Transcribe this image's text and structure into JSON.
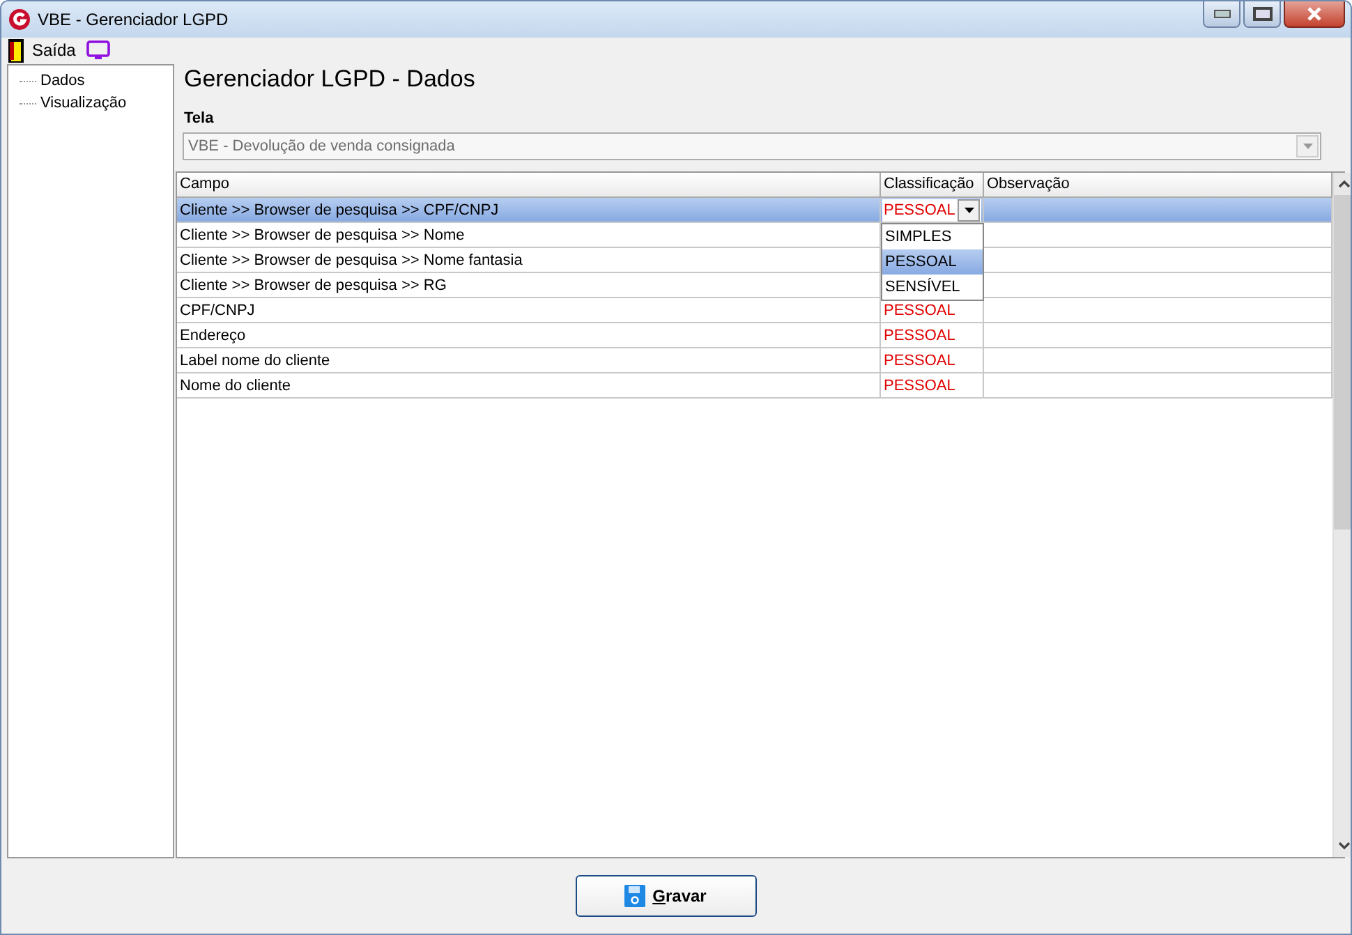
{
  "window": {
    "title": "VBE - Gerenciador LGPD"
  },
  "menu": [
    {
      "label": "Saída",
      "kind": "exit"
    },
    {
      "kind": "screen"
    }
  ],
  "sidebar": {
    "items": [
      {
        "label": "Dados"
      },
      {
        "label": "Visualização"
      }
    ]
  },
  "heading": "Gerenciador LGPD - Dados",
  "tela": {
    "label": "Tela",
    "value": "VBE - Devolução de venda consignada",
    "disabled": true
  },
  "table": {
    "columns": [
      "Campo",
      "Classificação",
      "Observação"
    ],
    "rows": [
      {
        "campo": "Cliente >> Browser de pesquisa >> CPF/CNPJ",
        "classificacao": "PESSOAL",
        "selected": true
      },
      {
        "campo": "Cliente >> Browser de pesquisa >> Nome",
        "selected": false
      },
      {
        "campo": "Cliente >> Browser de pesquisa >> Nome fantasia",
        "selected": false
      },
      {
        "campo": "Cliente >> Browser de pesquisa >> RG",
        "selected": false
      },
      {
        "campo": "CPF/CNPJ",
        "classificacao": "PESSOAL",
        "selected": false
      },
      {
        "campo": "Endereço",
        "classificacao": "PESSOAL",
        "selected": false
      },
      {
        "campo": "Label nome do cliente",
        "classificacao": "PESSOAL",
        "selected": false
      },
      {
        "campo": "Nome do cliente",
        "classificacao": "PESSOAL",
        "selected": false
      }
    ],
    "dropdown": {
      "options": [
        {
          "label": "SIMPLES",
          "selected": false
        },
        {
          "label": "PESSOAL",
          "selected": true
        },
        {
          "label": "SENSÍVEL",
          "selected": false
        }
      ]
    }
  },
  "buttons": [
    {
      "label": "Gravar"
    }
  ]
}
